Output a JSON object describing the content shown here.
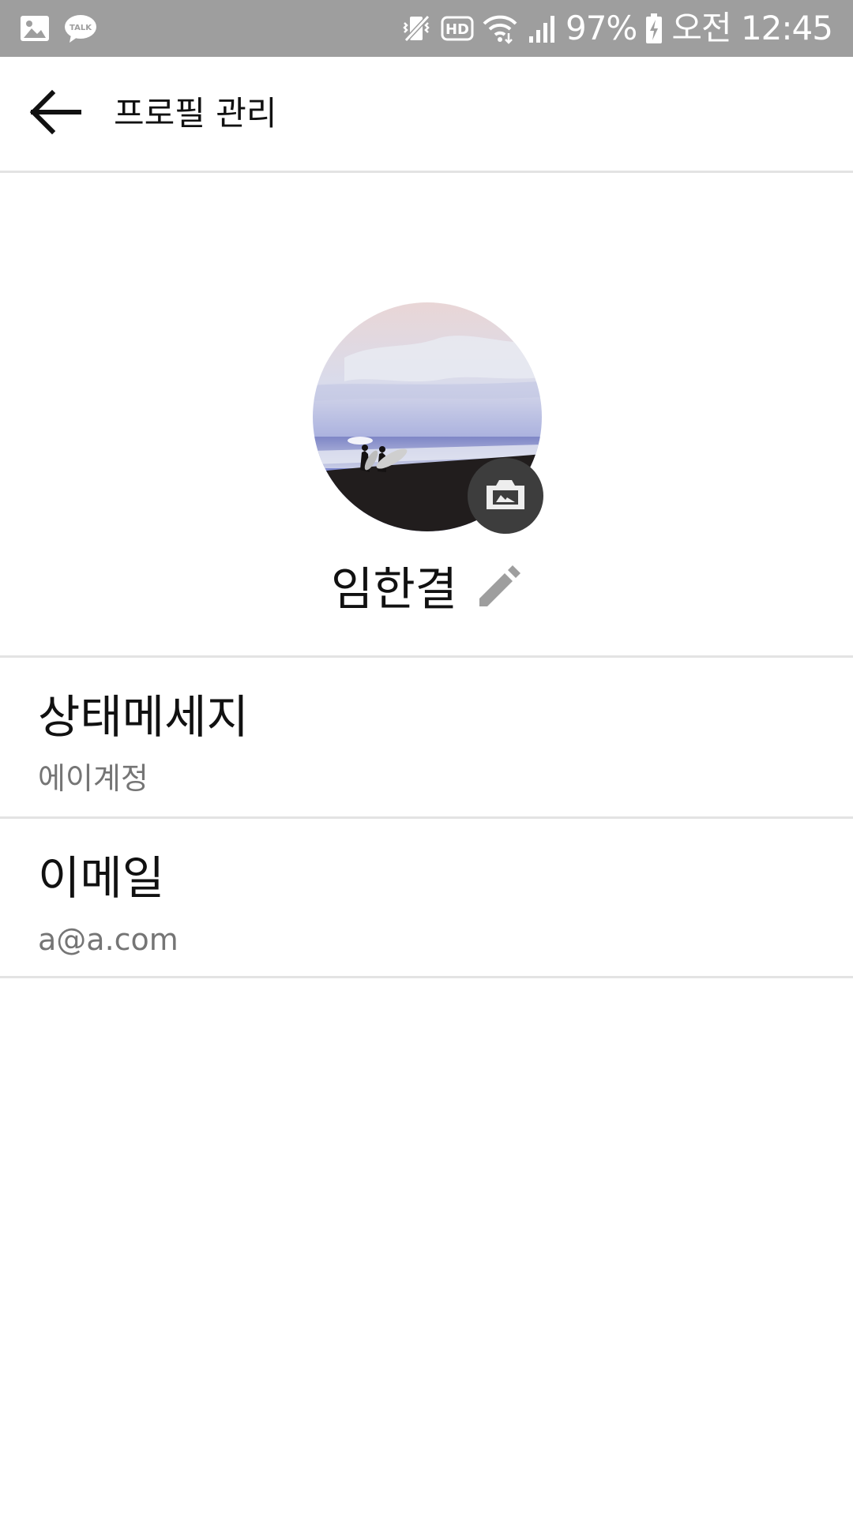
{
  "status_bar": {
    "left_icons": [
      "image-icon",
      "talk-icon"
    ],
    "talk_badge_text": "TALK",
    "right_icons": [
      "mute-vibrate-icon",
      "hd-icon",
      "wifi-icon",
      "signal-icon"
    ],
    "hd_text": "HD",
    "battery_percent": "97%",
    "battery_icon": "battery-charging-icon",
    "time": "오전 12:45"
  },
  "app_bar": {
    "back_icon": "arrow-left-icon",
    "title": "프로필 관리"
  },
  "profile": {
    "photo": "beach-surfers-photo",
    "camera_icon": "camera-switch-icon",
    "name": "임한결",
    "edit_icon": "pencil-icon"
  },
  "info": [
    {
      "label": "상태메세지",
      "value": "에이계정"
    },
    {
      "label": "이메일",
      "value": "a@a.com"
    }
  ],
  "colors": {
    "status_bar_bg": "#9e9e9e",
    "divider": "#e3e3e3",
    "secondary_text": "#757575",
    "icon_gray": "#9e9e9e"
  }
}
